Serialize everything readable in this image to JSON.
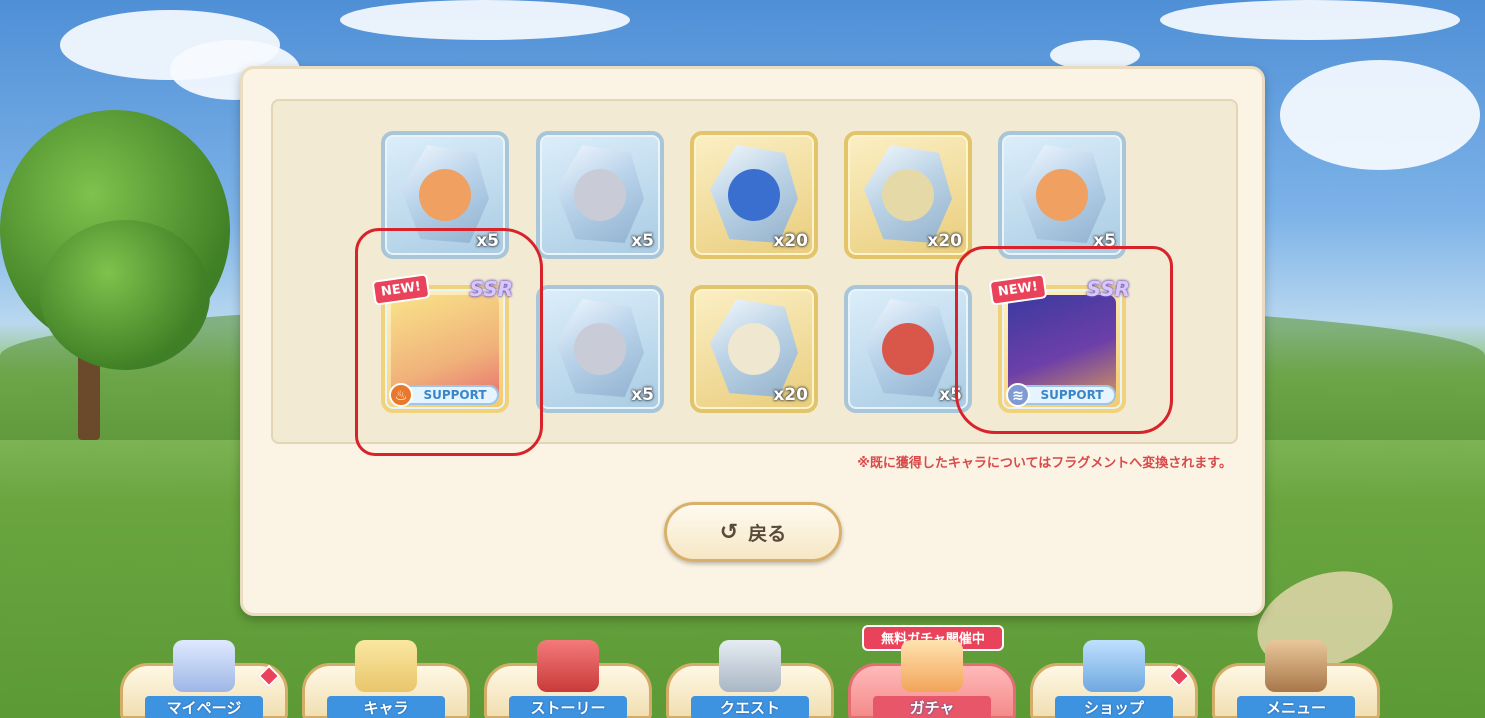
{
  "cards": [
    {
      "qty": "x5",
      "type": "fragment",
      "frame": "blue",
      "hair": "#f0a060",
      "tag": ""
    },
    {
      "qty": "x5",
      "type": "fragment",
      "frame": "blue",
      "hair": "#c9ccd6",
      "tag": ""
    },
    {
      "qty": "x20",
      "type": "fragment",
      "frame": "gold",
      "hair": "#3a6fd0",
      "tag": ""
    },
    {
      "qty": "x20",
      "type": "fragment",
      "frame": "gold",
      "hair": "#e6d9a8",
      "tag": ""
    },
    {
      "qty": "x5",
      "type": "fragment",
      "frame": "blue",
      "hair": "#f0a060",
      "tag": ""
    },
    {
      "qty": "",
      "type": "ssr",
      "new_label": "NEW!",
      "rarity": "SSR",
      "support_label": "SUPPORT",
      "hair": "#f4d46a"
    },
    {
      "qty": "x5",
      "type": "fragment",
      "frame": "blue",
      "hair": "#c9ccd6",
      "tag": ""
    },
    {
      "qty": "x20",
      "type": "fragment",
      "frame": "gold",
      "hair": "#efe7cf",
      "tag": ""
    },
    {
      "qty": "x5",
      "type": "fragment",
      "frame": "blue",
      "hair": "#d9574a",
      "tag": ""
    },
    {
      "qty": "",
      "type": "ssr",
      "new_label": "NEW!",
      "rarity": "SSR",
      "support_label": "SUPPORT",
      "hair": "#3a3aa0"
    }
  ],
  "notice": "※既に獲得したキャラについてはフラグメントへ変換されます。",
  "back_button": {
    "label": "戻る",
    "icon": "undo-arrow-icon"
  },
  "promo_banner": "無料ガチャ開催中",
  "nav": [
    {
      "label": "マイページ",
      "icon": "castle-icon",
      "dot": true
    },
    {
      "label": "キャラ",
      "icon": "character-icon",
      "dot": false
    },
    {
      "label": "ストーリー",
      "icon": "book-icon",
      "dot": false
    },
    {
      "label": "クエスト",
      "icon": "swords-icon",
      "dot": false
    },
    {
      "label": "ガチャ",
      "icon": "gacha-icon",
      "dot": false,
      "active": true
    },
    {
      "label": "ショップ",
      "icon": "shop-icon",
      "dot": true
    },
    {
      "label": "メニュー",
      "icon": "bag-icon",
      "dot": false
    }
  ],
  "colors": {
    "accent_red": "#d8232a",
    "nav_blue": "#3e93e0",
    "panel": "#fbf4e4"
  }
}
